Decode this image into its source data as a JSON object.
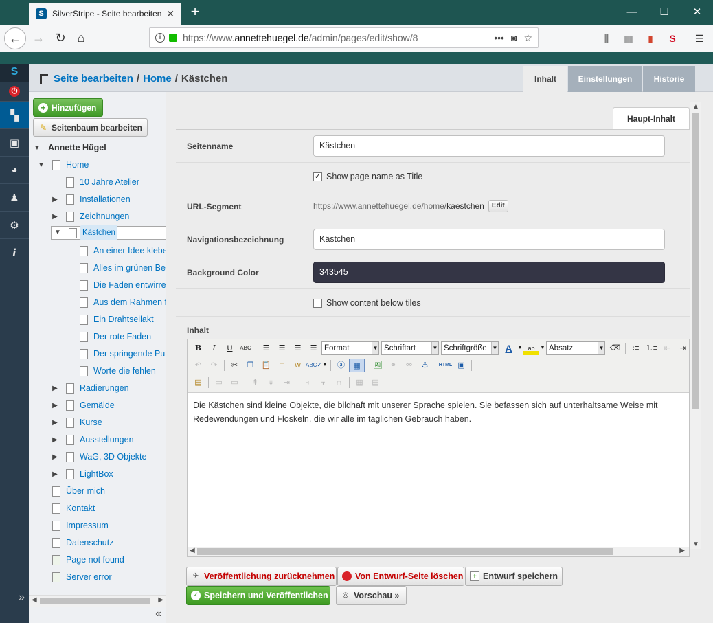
{
  "browser": {
    "tab_title": "SilverStripe - Seite bearbeiten",
    "url_prefix": "https://www.",
    "url_domain": "annettehuegel.de",
    "url_path": "/admin/pages/edit/show/8",
    "more_label": "•••"
  },
  "header": {
    "crumb_edit": "Seite bearbeiten",
    "crumb_sep": "/",
    "crumb_home": "Home",
    "crumb_current": "Kästchen",
    "tabs": [
      "Inhalt",
      "Einstellungen",
      "Historie"
    ]
  },
  "tree": {
    "add_label": "Hinzufügen",
    "edit_tree_label": "Seitenbaum bearbeiten",
    "root": "Annette Hügel",
    "nodes": [
      "Home",
      "10 Jahre Atelier",
      "Installationen",
      "Zeichnungen",
      "Kästchen",
      "An einer Idee kleben",
      "Alles im grünen Bereich",
      "Die Fäden entwirren",
      "Aus dem Rahmen fallen",
      "Ein Drahtseilakt",
      "Der rote Faden",
      "Der springende Punkt",
      "Worte die fehlen",
      "Radierungen",
      "Gemälde",
      "Kurse",
      "Ausstellungen",
      "WaG, 3D Objekte",
      "LightBox",
      "Über mich",
      "Kontakt",
      "Impressum",
      "Datenschutz",
      "Page not found",
      "Server error"
    ]
  },
  "form": {
    "subtab": "Haupt-Inhalt",
    "seitenname_label": "Seitenname",
    "seitenname_value": "Kästchen",
    "show_title_label": "Show page name as Title",
    "url_label": "URL-Segment",
    "url_base": "https://www.annettehuegel.de/home/",
    "url_segment": "kaestchen",
    "url_edit": "Edit",
    "nav_label": "Navigationsbezeichnung",
    "nav_value": "Kästchen",
    "bg_label": "Background Color",
    "bg_value": "343545",
    "bg_color": "#343545",
    "below_tiles_label": "Show content below tiles",
    "inhalt_label": "Inhalt",
    "editor": {
      "format": "Format",
      "font": "Schriftart",
      "size": "Schriftgröße",
      "paragraph": "Absatz",
      "body": "Die Kästchen sind kleine Objekte, die bildhaft mit unserer Sprache spielen. Sie befassen sich auf unterhaltsame Weise mit Redewendungen und Floskeln, die wir alle im täglichen Gebrauch haben."
    }
  },
  "actions": {
    "unpublish": "Veröffentlichung zurücknehmen",
    "delete_draft": "Von Entwurf-Seite löschen",
    "save_draft": "Entwurf speichern",
    "save_publish": "Speichern und Veröffentlichen",
    "preview": "Vorschau »"
  },
  "colors": {
    "brand": "#005b94",
    "link": "#0073c1",
    "publish_green": "#3e9a22",
    "danger_red": "#c40000"
  }
}
